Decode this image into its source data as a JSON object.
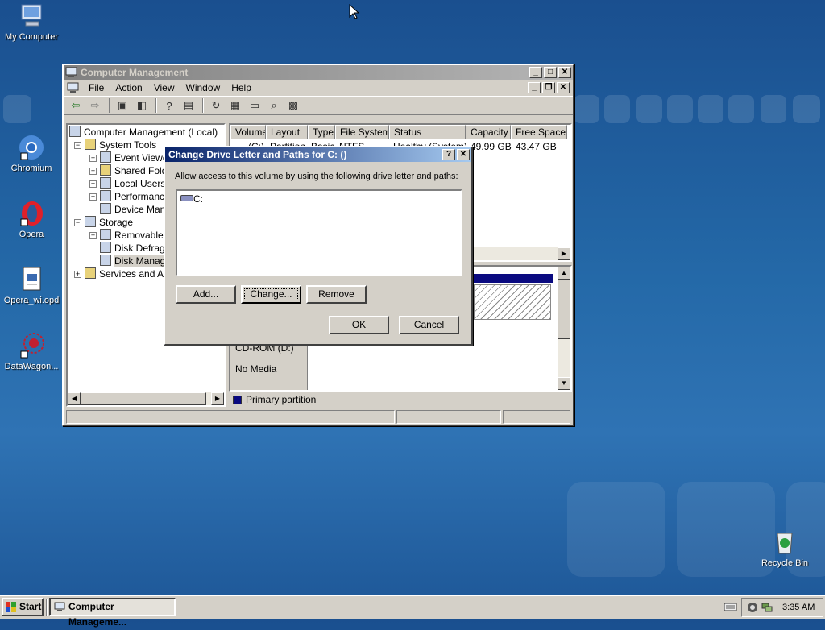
{
  "desktop": {
    "icons": [
      {
        "label": "My Computer",
        "icon": "my-computer-icon"
      },
      {
        "label": "Chromium",
        "icon": "chromium-icon"
      },
      {
        "label": "Opera",
        "icon": "opera-icon"
      },
      {
        "label": "Opera_wi.opd",
        "icon": "document-icon"
      },
      {
        "label": "DataWagon...",
        "icon": "datawagon-icon"
      },
      {
        "label": "Recycle Bin",
        "icon": "recycle-bin-icon"
      }
    ]
  },
  "main_window": {
    "title": "Computer Management",
    "menu": [
      "File",
      "Action",
      "View",
      "Window",
      "Help"
    ],
    "tree": {
      "root": "Computer Management (Local)",
      "system_tools": "System Tools",
      "event_viewer": "Event Viewe",
      "shared_folders": "Shared Folde",
      "local_users": "Local Users a",
      "performance": "Performance",
      "device_manager": "Device Mana",
      "storage": "Storage",
      "removable": "Removable S",
      "defrag": "Disk Defragn",
      "disk_mgmt": "Disk Manage",
      "services": "Services and App"
    },
    "columns": [
      "Volume",
      "Layout",
      "Type",
      "File System",
      "Status",
      "Capacity",
      "Free Space"
    ],
    "row": {
      "volume": "(C:)",
      "layout": "Partition",
      "type": "Basic",
      "fs": "NTFS",
      "status": "Healthy (System)",
      "capacity": "49.99 GB",
      "free": "43.47 GB"
    },
    "cdrom": {
      "name": "CD-ROM (D:)",
      "media": "No Media"
    },
    "legend": "Primary partition"
  },
  "dialog": {
    "title": "Change Drive Letter and Paths for C: ()",
    "help_btn": "?",
    "close_btn": "✕",
    "description": "Allow access to this volume by using the following drive letter and paths:",
    "list_item": "C:",
    "buttons": {
      "add": "Add...",
      "change": "Change...",
      "remove": "Remove",
      "ok": "OK",
      "cancel": "Cancel"
    }
  },
  "taskbar": {
    "start": "Start",
    "task": "Computer Manageme...",
    "clock": "3:35 AM"
  }
}
